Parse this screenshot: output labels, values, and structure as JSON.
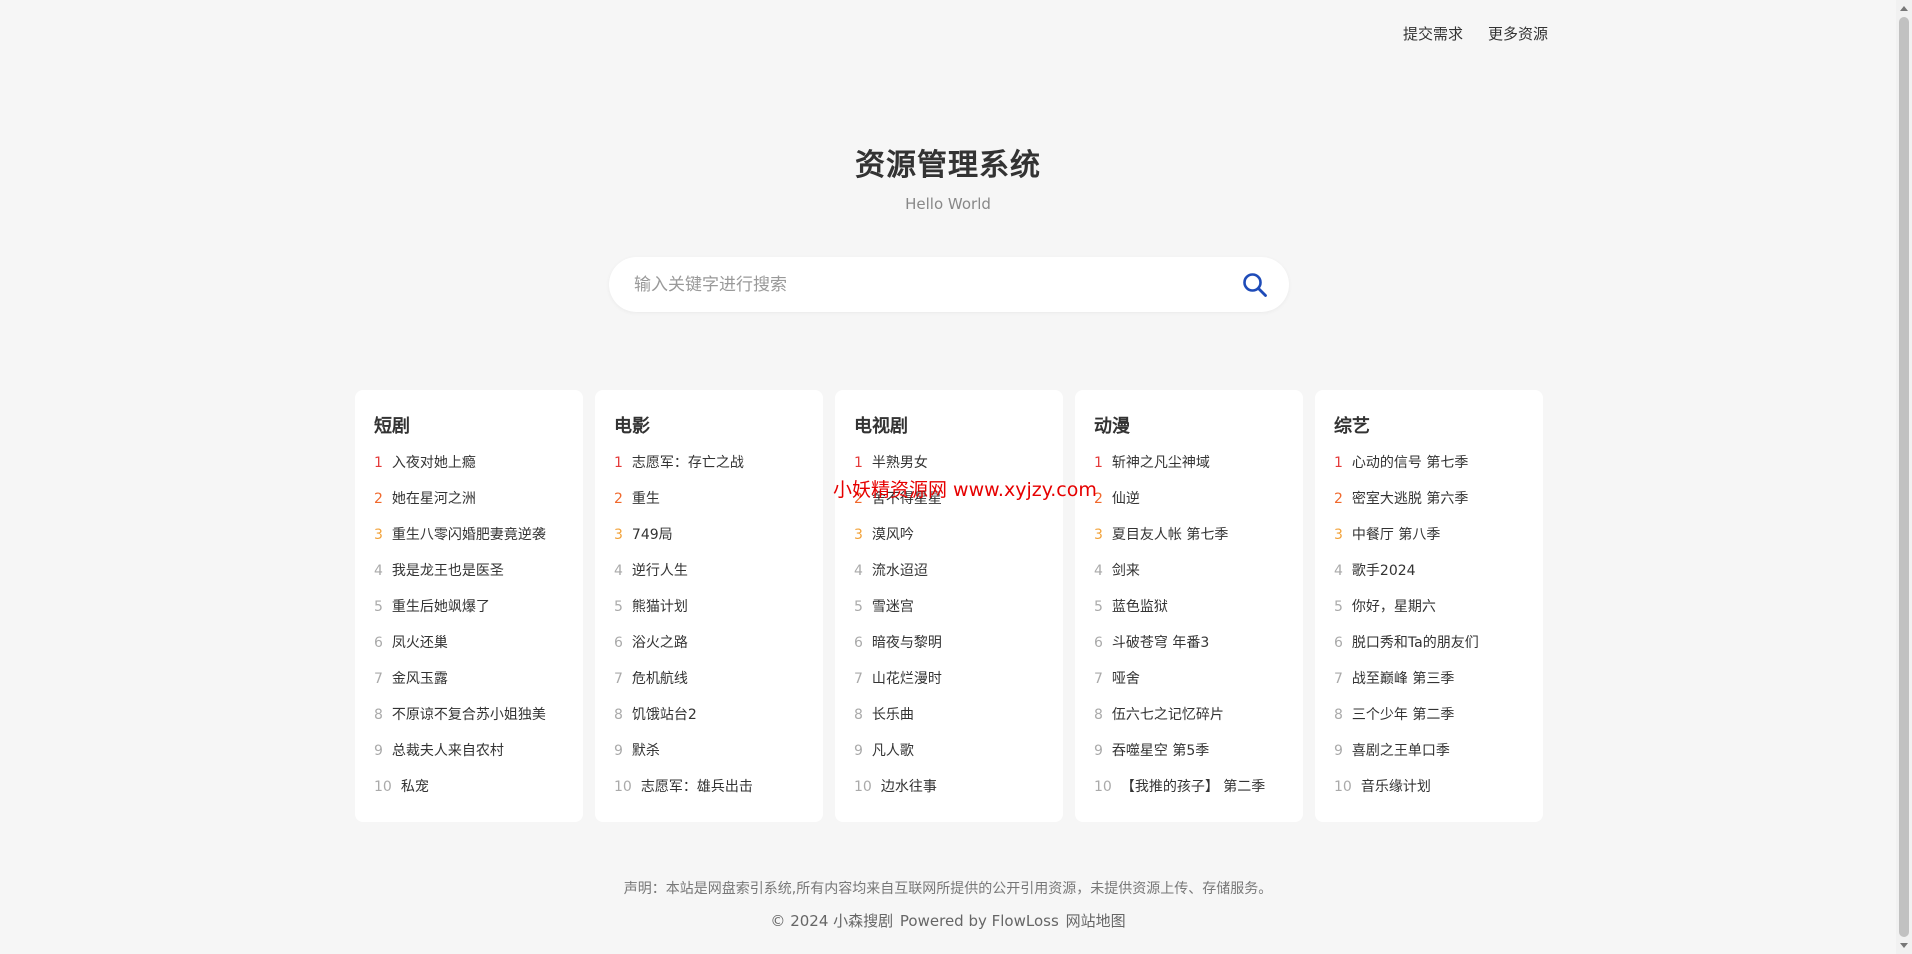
{
  "nav": {
    "submit_request": "提交需求",
    "more_resources": "更多资源"
  },
  "header": {
    "title": "资源管理系统",
    "subtitle": "Hello World"
  },
  "search": {
    "placeholder": "输入关键字进行搜索",
    "value": "",
    "icon": "search-icon",
    "icon_color": "#1e4bb8"
  },
  "watermark": "小妖精资源网 www.xyjzy.com",
  "colors": {
    "rank1": "#e43b3b",
    "rank2": "#f0692d",
    "rank3": "#f2a33b",
    "rank_other": "#aaaaaa",
    "watermark": "#e60000"
  },
  "categories": [
    {
      "title": "短剧",
      "items": [
        "入夜对她上瘾",
        "她在星河之洲",
        "重生八零闪婚肥妻竟逆袭",
        "我是龙王也是医圣",
        "重生后她飒爆了",
        "凤火还巢",
        "金风玉露",
        "不原谅不复合苏小姐独美",
        "总裁夫人来自农村",
        "私宠"
      ]
    },
    {
      "title": "电影",
      "items": [
        "志愿军：存亡之战",
        "重生",
        "749局",
        "逆行人生",
        "熊猫计划",
        "浴火之路",
        "危机航线",
        "饥饿站台2",
        "默杀",
        "志愿军：雄兵出击"
      ]
    },
    {
      "title": "电视剧",
      "items": [
        "半熟男女",
        "舍不得星星",
        "漠风吟",
        "流水迢迢",
        "雪迷宫",
        "暗夜与黎明",
        "山花烂漫时",
        "长乐曲",
        "凡人歌",
        "边水往事"
      ]
    },
    {
      "title": "动漫",
      "items": [
        "斩神之凡尘神域",
        "仙逆",
        "夏目友人帐 第七季",
        "剑来",
        "蓝色监狱",
        "斗破苍穹 年番3",
        "哑舍",
        "伍六七之记忆碎片",
        "吞噬星空 第5季",
        "【我推的孩子】 第二季"
      ]
    },
    {
      "title": "综艺",
      "items": [
        "心动的信号 第七季",
        "密室大逃脱 第六季",
        "中餐厅 第八季",
        "歌手2024",
        "你好，星期六",
        "脱口秀和Ta的朋友们",
        "战至巅峰 第三季",
        "三个少年 第二季",
        "喜剧之王单口季",
        "音乐缘计划"
      ]
    }
  ],
  "footer": {
    "disclaimer": "声明：本站是网盘索引系统,所有内容均来自互联网所提供的公开引用资源，未提供资源上传、存储服务。",
    "copyright": "© 2024 小森搜剧",
    "powered_by": "Powered by FlowLoss",
    "sitemap": "网站地图"
  }
}
